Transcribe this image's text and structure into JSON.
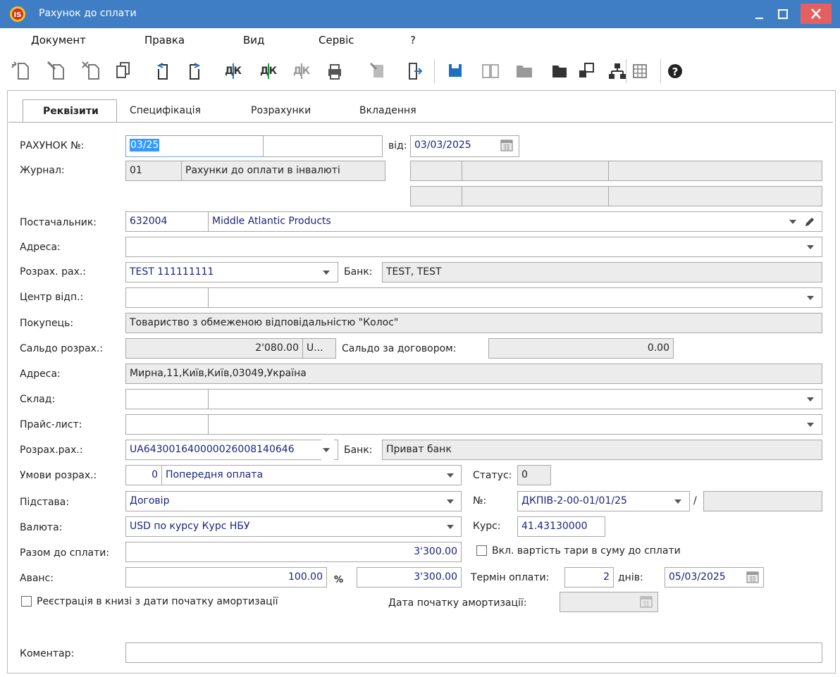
{
  "window": {
    "title": "Рахунок до сплати",
    "logo_text": "IS",
    "minimize": "_",
    "maximize": "□",
    "close": "✕"
  },
  "menu": [
    "Документ",
    "Правка",
    "Вид",
    "Сервіс",
    "?"
  ],
  "toolbar": {
    "text_icons": [
      "ДК",
      "ДК",
      "ДК"
    ],
    "help": "?"
  },
  "tabs": [
    "Реквізити",
    "Специфікація",
    "Розрахунки",
    "Вкладення"
  ],
  "labels": {
    "invoice_no": "РАХУНОК №:",
    "from": "від:",
    "journal": "Журнал:",
    "supplier": "Постачальник:",
    "address": "Адреса:",
    "settle_acc": "Розрах. рах.:",
    "bank": "Банк:",
    "resp_center": "Центр відп.:",
    "buyer": "Покупець:",
    "settle_balance": "Сальдо розрах.:",
    "contract_balance": "Сальдо за договором:",
    "address2": "Адреса:",
    "warehouse": "Склад:",
    "pricelist": "Прайс-лист:",
    "settle_acc2": "Розрах.рах.:",
    "bank2": "Банк:",
    "terms": "Умови розрах.:",
    "status": "Статус:",
    "basis": "Підстава:",
    "number": "№:",
    "currency": "Валюта:",
    "rate": "Курс:",
    "total": "Разом до сплати:",
    "tare_checkbox": "Вкл. вартість тари в суму до сплати",
    "advance": "Аванс:",
    "percent": "%",
    "payment_term": "Термін оплати:",
    "days": "днів:",
    "register_checkbox": "Реєстрація в книзі з дати початку амортизації",
    "amort_date": "Дата початку амортизації:",
    "comment": "Коментар:"
  },
  "values": {
    "invoice_no": "03/25",
    "invoice_date": "03/03/2025",
    "journal_code": "01",
    "journal_name": "Рахунки до оплати в інвалюті",
    "supplier_code": "632004",
    "supplier_name": "Middle Atlantic Products",
    "address": "",
    "settle_acc": "TEST 111111111",
    "bank": "TEST, TEST",
    "buyer": "Товариство з обмеженою відповідальністю \"Колос\"",
    "settle_balance": "2'080.00",
    "settle_balance_cur": "U...",
    "contract_balance": "0.00",
    "buyer_address": "Мирна,11,Київ,Київ,03049,Україна",
    "settle_acc2": "UA643001640000026008140646",
    "bank2": "Приват банк",
    "terms_code": "0",
    "terms_name": "Попередня оплата",
    "status": "0",
    "basis": "Договір",
    "contract_no": "ДКПІВ-2-00-01/01/25",
    "slash": "/",
    "currency": "USD по курсу Курс НБУ",
    "rate": "41.43130000",
    "total": "3'300.00",
    "advance_pct": "100.00",
    "advance_sum": "3'300.00",
    "term_days": "2",
    "due_date": "05/03/2025",
    "comment": ""
  }
}
